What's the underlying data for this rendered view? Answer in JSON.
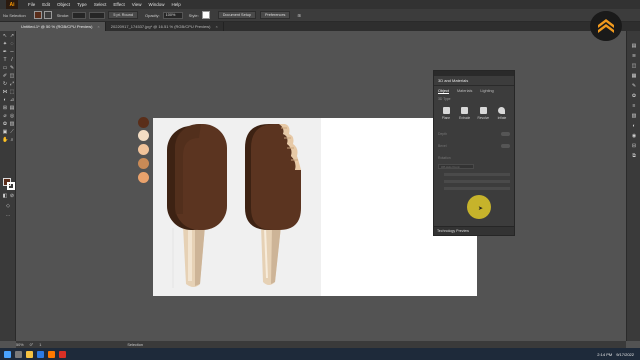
{
  "menubar": {
    "app_icon": "Ai",
    "items": [
      "File",
      "Edit",
      "Object",
      "Type",
      "Select",
      "Effect",
      "View",
      "Window",
      "Help"
    ]
  },
  "controlbar": {
    "selection_label": "No Selection",
    "stroke_label": "Stroke:",
    "brush_value": "5 pt. Round",
    "opacity_label": "Opacity:",
    "opacity_value": "100%",
    "style_label": "Style:",
    "document_setup_button": "Document Setup",
    "preferences_button": "Preferences"
  },
  "tabs": [
    {
      "label": "Untitled-1* @ 50 % (RGB/CPU Preview)",
      "active": true
    },
    {
      "label": "20220917_174537.jpg* @ 16.51 % (RGB/CPU Preview)",
      "active": false
    }
  ],
  "palette_colors": [
    "#5a2e19",
    "#f3ddc4",
    "#f1c39a",
    "#c98a56",
    "#e9a26c"
  ],
  "colors": {
    "chocolate": "#5b3420",
    "chocolate_dark": "#3d2213",
    "stick": "#e8d3b8",
    "accent_cursor": "#d8c22a"
  },
  "panel": {
    "title": "3D and Materials",
    "tabs": [
      "Object",
      "Materials",
      "Lighting"
    ],
    "subtitle": "3D Type",
    "types": [
      "Plane",
      "Extrude",
      "Revolve",
      "Inflate"
    ],
    "rows": [
      "Depth",
      "Bevel",
      "Rotation"
    ],
    "presets_field": "Off-Axis Front",
    "footer": "Technology Preview"
  },
  "statusbar": {
    "zoom": "50%",
    "angle": "0°",
    "page": "1",
    "tool": "Selection"
  },
  "taskbar": {
    "time": "2:14 PM",
    "date": "9/17/2022"
  }
}
